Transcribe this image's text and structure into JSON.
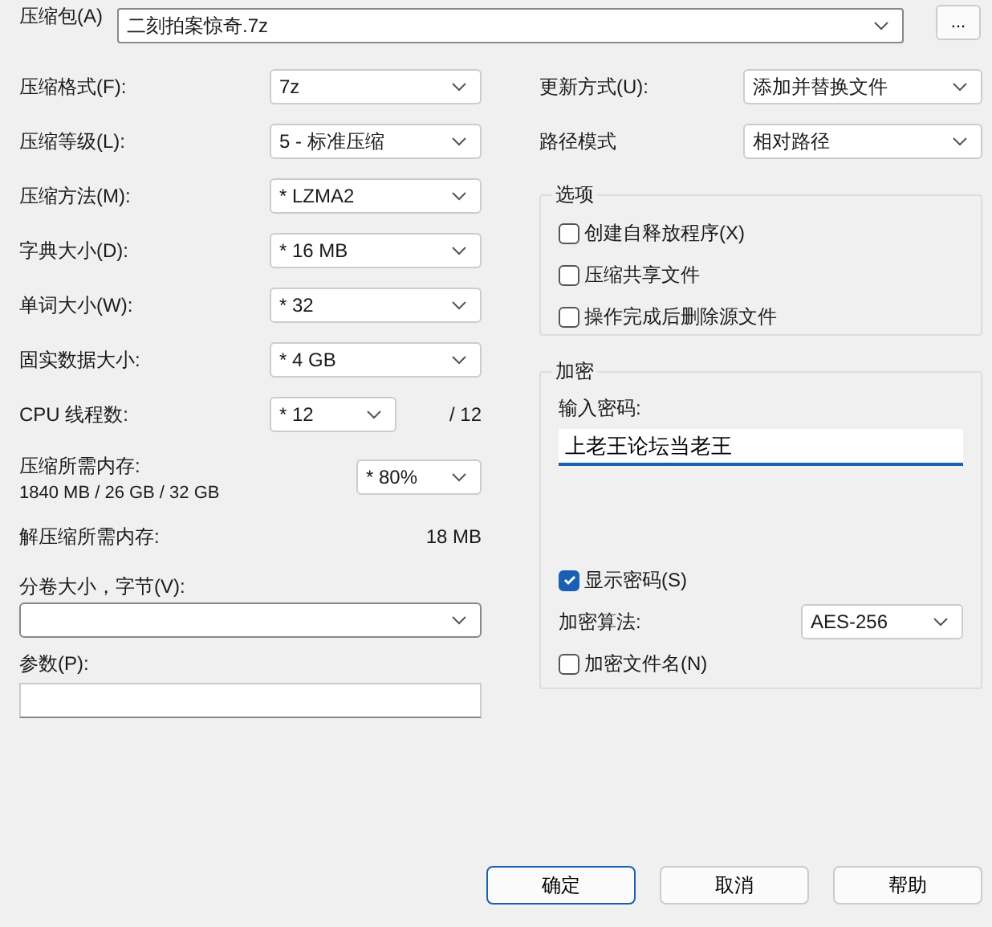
{
  "archive": {
    "label": "压缩包(A)",
    "value": "二刻拍案惊奇.7z",
    "browse": "..."
  },
  "left_fields": [
    {
      "kind": "combo",
      "label": "压缩格式(F):",
      "value": "7z"
    },
    {
      "kind": "combo",
      "label": "压缩等级(L):",
      "value": "5 - 标准压缩"
    },
    {
      "kind": "combo",
      "label": "压缩方法(M):",
      "value": "* LZMA2"
    },
    {
      "kind": "combo",
      "label": "字典大小(D):",
      "value": "* 16 MB"
    },
    {
      "kind": "combo",
      "label": "单词大小(W):",
      "value": "* 32"
    },
    {
      "kind": "combo",
      "label": "固实数据大小:",
      "value": "* 4 GB"
    },
    {
      "kind": "threads",
      "label": "CPU 线程数:",
      "value": "* 12",
      "note": "/ 12"
    },
    {
      "kind": "memory",
      "label": "压缩所需内存:",
      "detail": "1840 MB / 26 GB / 32 GB",
      "value": "* 80%"
    },
    {
      "kind": "readout",
      "label": "解压缩所需内存:",
      "value": "18 MB"
    }
  ],
  "volume": {
    "label": "分卷大小，字节(V):"
  },
  "params": {
    "label": "参数(P):"
  },
  "right_fields": [
    {
      "label": "更新方式(U):",
      "value": "添加并替换文件"
    },
    {
      "label": "路径模式",
      "value": "相对路径"
    }
  ],
  "options": {
    "title": "选项",
    "items": [
      {
        "label": "创建自释放程序(X)",
        "checked": false
      },
      {
        "label": "压缩共享文件",
        "checked": false
      },
      {
        "label": "操作完成后删除源文件",
        "checked": false
      }
    ]
  },
  "encryption": {
    "title": "加密",
    "password_label": "输入密码:",
    "password": "上老王论坛当老王",
    "show_password": {
      "label": "显示密码(S)",
      "checked": true
    },
    "method_label": "加密算法:",
    "method": "AES-256",
    "encrypt_names": {
      "label": "加密文件名(N)",
      "checked": false
    }
  },
  "buttons": [
    {
      "label": "确定",
      "default": true
    },
    {
      "label": "取消",
      "default": false
    },
    {
      "label": "帮助",
      "default": false
    }
  ]
}
